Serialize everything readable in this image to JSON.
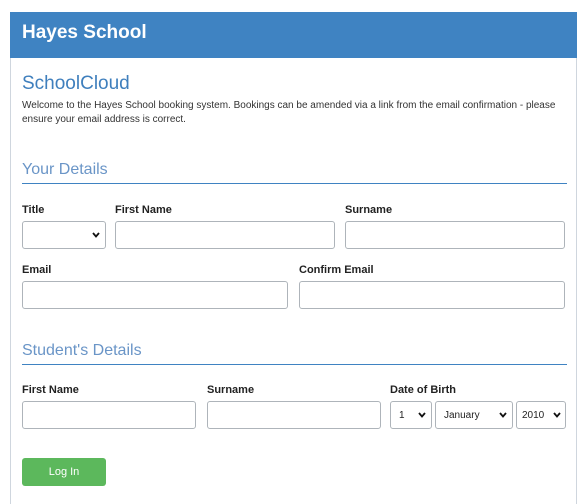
{
  "header": {
    "title": "Hayes School"
  },
  "app": {
    "title": "SchoolCloud",
    "intro": "Welcome to the Hayes School booking system. Bookings can be amended via a link from the email confirmation - please ensure your email address is correct."
  },
  "your_details": {
    "heading": "Your Details",
    "title_label": "Title",
    "title_value": "",
    "first_name_label": "First Name",
    "first_name_value": "",
    "surname_label": "Surname",
    "surname_value": "",
    "email_label": "Email",
    "email_value": "",
    "confirm_email_label": "Confirm Email",
    "confirm_email_value": ""
  },
  "student_details": {
    "heading": "Student's Details",
    "first_name_label": "First Name",
    "surname_label": "Surname",
    "dob_label": "Date of Birth",
    "dob_day": "1",
    "dob_month": "January",
    "dob_year": "2010"
  },
  "actions": {
    "login_label": "Log In"
  },
  "colors": {
    "header": "#3f83c2",
    "accent": "#3f7fbd",
    "button": "#5cb85c"
  }
}
